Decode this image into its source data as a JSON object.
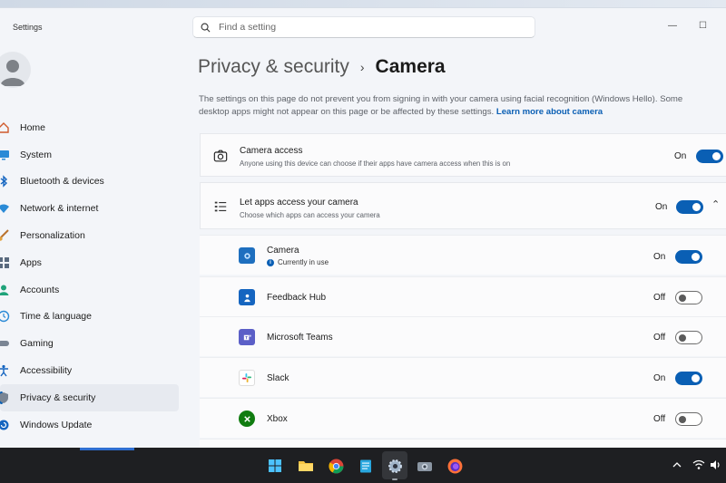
{
  "window": {
    "title": "Settings",
    "minimize_glyph": "—",
    "maximize_glyph": "☐"
  },
  "search": {
    "placeholder": "Find a setting",
    "icon": "search-icon"
  },
  "sidebar": {
    "items": [
      {
        "label": "Home",
        "icon": "home-icon",
        "selected": false
      },
      {
        "label": "System",
        "icon": "monitor-icon",
        "selected": false
      },
      {
        "label": "Bluetooth & devices",
        "icon": "bluetooth-icon",
        "selected": false
      },
      {
        "label": "Network & internet",
        "icon": "wifi-icon",
        "selected": false
      },
      {
        "label": "Personalization",
        "icon": "brush-icon",
        "selected": false
      },
      {
        "label": "Apps",
        "icon": "apps-icon",
        "selected": false
      },
      {
        "label": "Accounts",
        "icon": "person-icon",
        "selected": false
      },
      {
        "label": "Time & language",
        "icon": "globe-clock-icon",
        "selected": false
      },
      {
        "label": "Gaming",
        "icon": "gamepad-icon",
        "selected": false
      },
      {
        "label": "Accessibility",
        "icon": "accessibility-icon",
        "selected": false
      },
      {
        "label": "Privacy & security",
        "icon": "shield-icon",
        "selected": true
      },
      {
        "label": "Windows Update",
        "icon": "update-icon",
        "selected": false
      }
    ]
  },
  "header": {
    "parent": "Privacy & security",
    "separator": "›",
    "current": "Camera"
  },
  "description": {
    "line1": "The settings on this page do not prevent you from signing in with your camera using facial recognition (Windows Hello). Some",
    "line2": "desktop apps might not appear on this page or be affected by these settings.",
    "link": "Learn more about camera"
  },
  "camera_access": {
    "title": "Camera access",
    "subtitle": "Anyone using this device can choose if their apps have camera access when this is on",
    "state": "On"
  },
  "let_apps": {
    "title": "Let apps access your camera",
    "subtitle": "Choose which apps can access your camera",
    "state": "On"
  },
  "apps": [
    {
      "name": "Camera",
      "state": "On",
      "status": "Currently in use",
      "icon": "camera-app-icon",
      "color": "#1e6fbf"
    },
    {
      "name": "Feedback Hub",
      "state": "Off",
      "icon": "feedback-hub-icon",
      "color": "#1565c0"
    },
    {
      "name": "Microsoft Teams",
      "state": "Off",
      "icon": "teams-icon",
      "color": "#5b5fc7"
    },
    {
      "name": "Slack",
      "state": "On",
      "icon": "slack-icon",
      "color": "#4a154b"
    },
    {
      "name": "Xbox",
      "state": "Off",
      "icon": "xbox-icon",
      "color": "#107c10"
    }
  ],
  "taskbar": {
    "icons": [
      "windows-start-icon",
      "file-explorer-icon",
      "chrome-icon",
      "notepad-icon",
      "settings-gear-icon",
      "camera-taskbar-icon",
      "firefox-icon"
    ],
    "tray": [
      "chevron-up-icon",
      "wifi-tray-icon",
      "volume-icon"
    ]
  },
  "colors": {
    "accent": "#0a5fb4",
    "window_bg": "#f3f5f9",
    "taskbar": "#1e1f22"
  }
}
